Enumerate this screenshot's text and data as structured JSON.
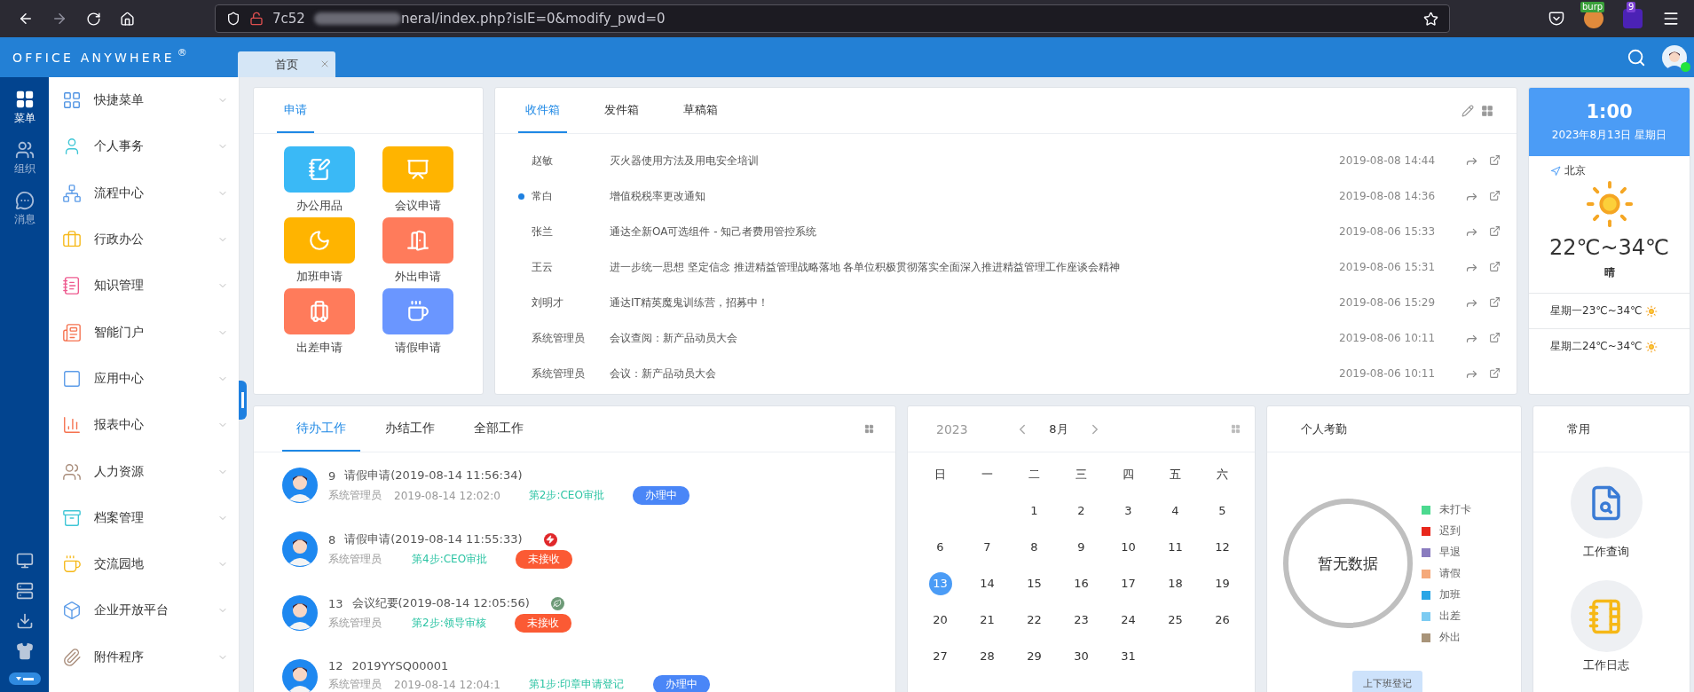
{
  "browser": {
    "url_start": "7c52",
    "url_end": "neral/index.php?isIE=0&modify_pwd=0",
    "extension_badges": [
      "burp",
      "9"
    ]
  },
  "header": {
    "logo": "OFFICE ANYWHERE",
    "trademark": "®"
  },
  "tabs": [
    {
      "label": "首页",
      "selected": true
    }
  ],
  "rail": [
    {
      "label": "菜单",
      "selected": true
    },
    {
      "label": "组织",
      "selected": false
    },
    {
      "label": "消息",
      "selected": false
    }
  ],
  "menu": [
    "快捷菜单",
    "个人事务",
    "流程中心",
    "行政办公",
    "知识管理",
    "智能门户",
    "应用中心",
    "报表中心",
    "人力资源",
    "档案管理",
    "交流园地",
    "企业开放平台",
    "附件程序"
  ],
  "apply_panel": {
    "title": "申请",
    "apps": [
      "办公用品",
      "会议申请",
      "加班申请",
      "外出申请",
      "出差申请",
      "请假申请"
    ]
  },
  "mail": {
    "tabs": [
      {
        "label": "收件箱",
        "selected": true
      },
      {
        "label": "发件箱",
        "selected": false
      },
      {
        "label": "草稿箱",
        "selected": false
      }
    ],
    "rows": [
      {
        "sender": "赵敏",
        "subject": "灭火器使用方法及用电安全培训",
        "time": "2019-08-08 14:44",
        "unread": false
      },
      {
        "sender": "常白",
        "subject": "增值税税率更改通知",
        "time": "2019-08-08 14:36",
        "unread": true
      },
      {
        "sender": "张兰",
        "subject": "通达全新OA可选组件 - 知己者费用管控系统",
        "time": "2019-08-06 15:33",
        "unread": false
      },
      {
        "sender": "王云",
        "subject": "进一步统一思想 坚定信念 推进精益管理战略落地 各单位积极贯彻落实全面深入推进精益管理工作座谈会精神",
        "time": "2019-08-06 15:31",
        "unread": false
      },
      {
        "sender": "刘明才",
        "subject": "通达IT精英魔鬼训练营，招募中！",
        "time": "2019-08-06 15:29",
        "unread": false
      },
      {
        "sender": "系统管理员",
        "subject": "会议查阅：新产品动员大会",
        "time": "2019-08-06 10:11",
        "unread": false
      },
      {
        "sender": "系统管理员",
        "subject": "会议：新产品动员大会",
        "time": "2019-08-06 10:11",
        "unread": false
      }
    ]
  },
  "weather": {
    "time": "1:00",
    "date": "2023年8月13日 星期日",
    "city": "北京",
    "temperature": "22℃~34℃",
    "condition": "晴",
    "forecast": [
      "星期一23℃~34℃",
      "星期二24℃~34℃"
    ]
  },
  "work": {
    "tabs": [
      {
        "label": "待办工作",
        "selected": true
      },
      {
        "label": "办结工作",
        "selected": false
      },
      {
        "label": "全部工作",
        "selected": false
      }
    ],
    "items": [
      {
        "number": "9",
        "title": "请假申请(2019-08-14 11:56:34)",
        "user": "系统管理员",
        "time": "2019-08-14 12:02:0",
        "step": "第2步:CEO审批",
        "status": {
          "label": "办理中",
          "color": "#4a86f7"
        }
      },
      {
        "number": "8",
        "title": "请假申请(2019-08-14 11:55:33)",
        "flag": {
          "kind": "lightning",
          "color": "#e0282b"
        },
        "user": "系统管理员",
        "step": "第4步:CEO审批",
        "status": {
          "label": "未接收",
          "color": "#fb5a34"
        }
      },
      {
        "number": "13",
        "title": "会议纪要(2019-08-14 12:05:56)",
        "flag": {
          "kind": "leaf",
          "color": "#6d9a77"
        },
        "user": "系统管理员",
        "step": "第2步:领导审核",
        "status": {
          "label": "未接收",
          "color": "#fb5a34"
        }
      },
      {
        "number": "12",
        "title": "2019YYSQ00001",
        "user": "系统管理员",
        "time": "2019-08-14 12:04:1",
        "step": "第1步:印章申请登记",
        "status": {
          "label": "办理中",
          "color": "#4a86f7"
        }
      }
    ]
  },
  "calendar": {
    "year": "2023",
    "month": "8月",
    "weekdays": [
      "日",
      "一",
      "二",
      "三",
      "四",
      "五",
      "六"
    ],
    "weeks": [
      [
        {
          "kind": "blank"
        },
        {
          "kind": "blank"
        },
        {
          "day": "1",
          "selected": false
        },
        {
          "day": "2",
          "selected": false
        },
        {
          "day": "3",
          "selected": false
        },
        {
          "day": "4",
          "selected": false
        },
        {
          "day": "5",
          "selected": false
        }
      ],
      [
        {
          "day": "6",
          "selected": false
        },
        {
          "day": "7",
          "selected": false
        },
        {
          "day": "8",
          "selected": false
        },
        {
          "day": "9",
          "selected": false
        },
        {
          "day": "10",
          "selected": false
        },
        {
          "day": "11",
          "selected": false
        },
        {
          "day": "12",
          "selected": false
        }
      ],
      [
        {
          "day": "13",
          "selected": true
        },
        {
          "day": "14",
          "selected": false
        },
        {
          "day": "15",
          "selected": false
        },
        {
          "day": "16",
          "selected": false
        },
        {
          "day": "17",
          "selected": false
        },
        {
          "day": "18",
          "selected": false
        },
        {
          "day": "19",
          "selected": false
        }
      ],
      [
        {
          "day": "20",
          "selected": false
        },
        {
          "day": "21",
          "selected": false
        },
        {
          "day": "22",
          "selected": false
        },
        {
          "day": "23",
          "selected": false
        },
        {
          "day": "24",
          "selected": false
        },
        {
          "day": "25",
          "selected": false
        },
        {
          "day": "26",
          "selected": false
        }
      ],
      [
        {
          "day": "27",
          "selected": false
        },
        {
          "day": "28",
          "selected": false
        },
        {
          "day": "29",
          "selected": false
        },
        {
          "day": "30",
          "selected": false
        },
        {
          "day": "31",
          "selected": false
        },
        {
          "kind": "blank"
        },
        {
          "kind": "blank"
        }
      ]
    ]
  },
  "attendance": {
    "title": "个人考勤",
    "empty_text": "暂无数据",
    "legend": [
      {
        "label": "未打卡",
        "color": "#4cd98f"
      },
      {
        "label": "迟到",
        "color": "#e8271c"
      },
      {
        "label": "早退",
        "color": "#8a7cbf"
      },
      {
        "label": "请假",
        "color": "#f5a97a"
      },
      {
        "label": "加班",
        "color": "#29a6e6"
      },
      {
        "label": "出差",
        "color": "#7ccbf2"
      },
      {
        "label": "外出",
        "color": "#a89479"
      }
    ],
    "button": "上下班登记"
  },
  "common": {
    "title": "常用",
    "items": [
      "工作查询",
      "工作日志"
    ]
  }
}
